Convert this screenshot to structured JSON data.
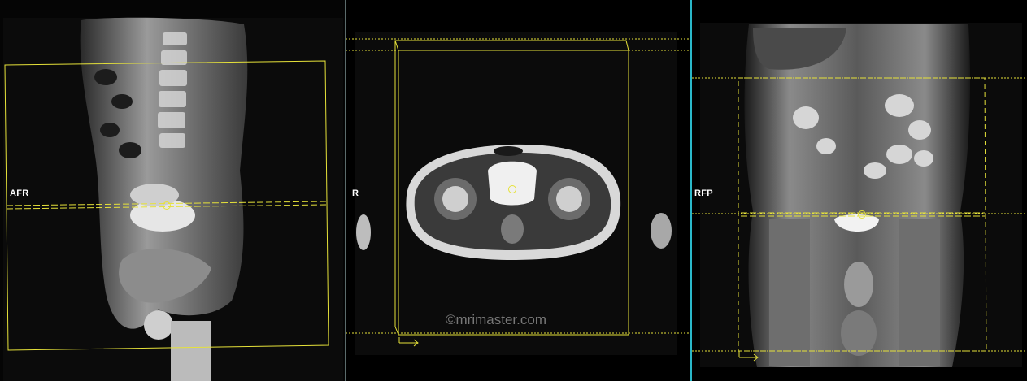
{
  "viewports": {
    "sagittal": {
      "orientation_label": "AFR"
    },
    "axial": {
      "orientation_label": "R"
    },
    "coronal": {
      "orientation_label": "RFP"
    }
  },
  "watermark": "©mrimaster.com",
  "colors": {
    "planning_box": "#e6e23a",
    "viewport_separator": "#5b6b6b",
    "active_separator": "#29b6c7",
    "background": "#000000"
  },
  "icons": {
    "slice_direction_arrow": "arrow-right-icon",
    "center_marker": "circle-marker-icon"
  }
}
